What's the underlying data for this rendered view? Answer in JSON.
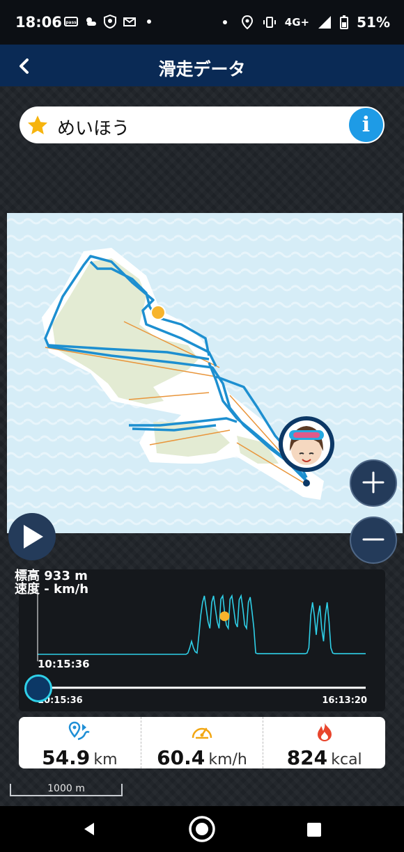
{
  "status_bar": {
    "time": "18:06",
    "network": "4G+",
    "battery": "51%",
    "left_icons": [
      "pass-icon",
      "weather-icon",
      "shield-icon",
      "mail-icon",
      "dot-icon"
    ],
    "right_icons": [
      "dot-icon",
      "location-icon",
      "vibrate-icon",
      "signal-icon",
      "battery-icon"
    ]
  },
  "header": {
    "title": "滑走データ",
    "back_icon": "chevron-left-icon"
  },
  "search": {
    "value": "めいほう",
    "star_icon": "star-icon",
    "info_label": "i"
  },
  "map": {
    "scale_label": "1000 m",
    "zoom_in_icon": "plus-icon",
    "zoom_out_icon": "minus-icon",
    "track_color": "#1d8fd0",
    "lift_color": "#e9953a",
    "marker_color": "#f7b42c"
  },
  "player": {
    "play_icon": "play-icon"
  },
  "chart": {
    "elevation_label": "標高 933 m",
    "speed_label": "速度 - km/h",
    "cursor_time": "10:15:36",
    "start_time": "10:15:36",
    "end_time": "16:13:20",
    "slider_position": 0
  },
  "chart_data": {
    "type": "line",
    "x_label": "",
    "y_label": "",
    "xlim": [
      "10:15:36",
      "16:13:20"
    ],
    "series": [
      {
        "values": [
          0,
          0,
          0,
          0,
          0,
          0,
          0,
          0,
          0,
          0,
          0,
          0,
          0,
          0,
          0,
          0,
          0,
          0,
          0,
          0,
          0,
          0,
          0,
          0,
          0,
          0,
          0,
          0,
          0,
          0,
          0,
          0,
          0,
          0,
          0,
          0,
          0,
          0,
          0,
          0,
          0,
          0,
          0,
          0,
          0,
          0,
          0,
          0,
          0,
          0,
          0,
          0,
          0,
          0,
          0,
          0,
          0,
          0,
          0,
          0,
          0,
          0,
          0,
          0,
          0,
          0,
          0,
          0,
          0,
          0,
          0,
          0,
          0,
          0,
          0,
          0,
          0,
          0,
          0,
          0,
          0,
          0,
          2,
          10,
          20,
          10,
          4,
          2,
          30,
          60,
          80,
          90,
          70,
          50,
          40,
          80,
          90,
          70,
          50,
          40,
          85,
          90,
          65,
          45,
          40,
          85,
          90,
          70,
          48,
          42,
          84,
          90,
          70,
          45,
          40,
          80,
          88,
          65,
          40,
          2,
          1,
          1,
          1,
          1,
          1,
          1,
          1,
          1,
          1,
          1,
          1,
          1,
          1,
          1,
          1,
          1,
          1,
          1,
          1,
          1,
          1,
          1,
          1,
          1,
          1,
          1,
          1,
          2,
          10,
          60,
          80,
          60,
          30,
          60,
          75,
          40,
          20,
          60,
          80,
          50,
          10,
          2,
          1,
          1,
          1,
          1,
          1,
          1,
          1,
          1,
          1,
          1,
          1,
          1,
          1,
          1,
          1,
          1,
          1,
          1
        ]
      }
    ],
    "marker_index": 102,
    "color": "#2fd0e8"
  },
  "stats": [
    {
      "icon": "route-pin-icon",
      "value": "54.9",
      "unit": "km"
    },
    {
      "icon": "speedometer-icon",
      "value": "60.4",
      "unit": "km/h"
    },
    {
      "icon": "flame-icon",
      "value": "824",
      "unit": "kcal"
    }
  ],
  "nav_bar": {
    "back_icon": "triangle-back-icon",
    "home_icon": "circle-home-icon",
    "recents_icon": "square-recents-icon"
  }
}
